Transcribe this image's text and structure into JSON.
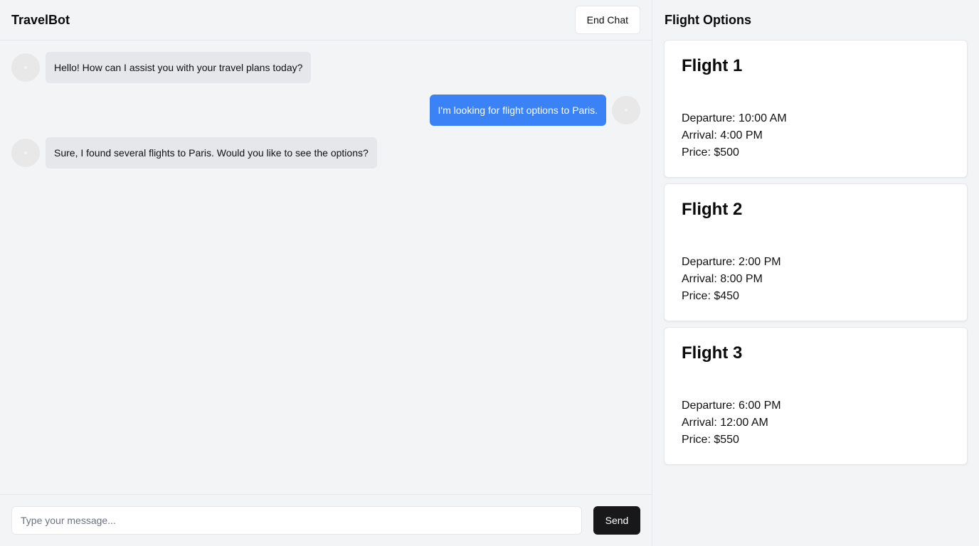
{
  "header": {
    "app_title": "TravelBot",
    "end_chat_label": "End Chat"
  },
  "messages": [
    {
      "sender": "bot",
      "text": "Hello! How can I assist you with your travel plans today?"
    },
    {
      "sender": "user",
      "text": "I'm looking for flight options to Paris."
    },
    {
      "sender": "bot",
      "text": "Sure, I found several flights to Paris. Would you like to see the options?"
    }
  ],
  "composer": {
    "placeholder": "Type your message...",
    "value": "",
    "send_label": "Send"
  },
  "options": {
    "title": "Flight Options",
    "flights": [
      {
        "name": "Flight 1",
        "departure": "Departure: 10:00 AM",
        "arrival": "Arrival: 4:00 PM",
        "price": "Price: $500"
      },
      {
        "name": "Flight 2",
        "departure": "Departure: 2:00 PM",
        "arrival": "Arrival: 8:00 PM",
        "price": "Price: $450"
      },
      {
        "name": "Flight 3",
        "departure": "Departure: 6:00 PM",
        "arrival": "Arrival: 12:00 AM",
        "price": "Price: $550"
      }
    ]
  },
  "colors": {
    "user_bubble": "#3b82f6",
    "bot_bubble": "#e5e7eb",
    "send_button": "#18181b",
    "background": "#f3f4f6"
  }
}
